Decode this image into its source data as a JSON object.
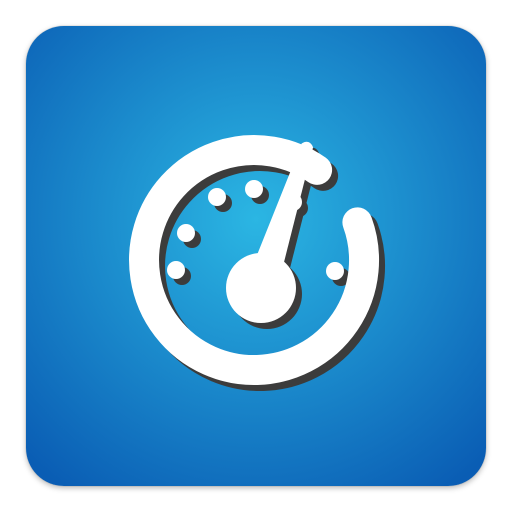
{
  "app_icon": {
    "icon": "speedometer-gauge-icon",
    "gauge_level": 0.85,
    "colors": {
      "background_center": "#2bb6e3",
      "background_edge": "#0a5db4",
      "glyph": "#ffffff",
      "glyph_shadow": "#3c3c3c"
    }
  }
}
